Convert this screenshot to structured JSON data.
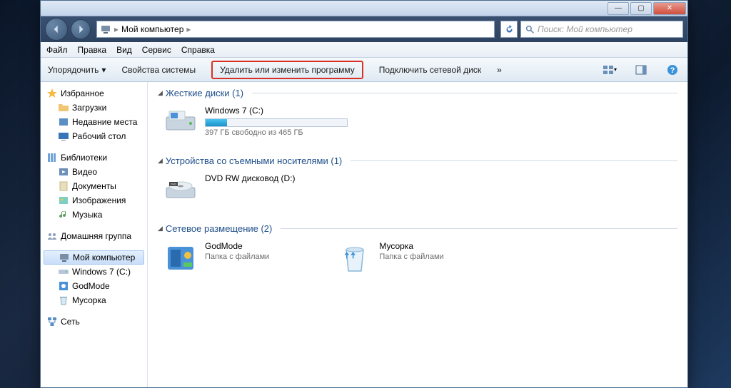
{
  "titlebar": {
    "min": "—",
    "max": "▢",
    "close": "✕"
  },
  "address": {
    "root": "Мой компьютер",
    "sep": "▸"
  },
  "search": {
    "placeholder": "Поиск: Мой компьютер"
  },
  "menu": {
    "file": "Файл",
    "edit": "Правка",
    "view": "Вид",
    "service": "Сервис",
    "help": "Справка"
  },
  "toolbar": {
    "organize": "Упорядочить",
    "system_props": "Свойства системы",
    "uninstall": "Удалить или изменить программу",
    "map_drive": "Подключить сетевой диск",
    "more": "»"
  },
  "sidebar": {
    "favorites": {
      "label": "Избранное",
      "items": [
        "Загрузки",
        "Недавние места",
        "Рабочий стол"
      ]
    },
    "libraries": {
      "label": "Библиотеки",
      "items": [
        "Видео",
        "Документы",
        "Изображения",
        "Музыка"
      ]
    },
    "homegroup": {
      "label": "Домашняя группа"
    },
    "computer": {
      "label": "Мой компьютер",
      "items": [
        "Windows 7 (C:)",
        "GodMode",
        "Мусорка"
      ]
    },
    "network": {
      "label": "Сеть"
    }
  },
  "main": {
    "cat_hdd": {
      "title": "Жесткие диски (1)",
      "drive": "Windows 7 (C:)",
      "free": "397 ГБ свободно из 465 ГБ"
    },
    "cat_rem": {
      "title": "Устройства со съемными носителями (1)",
      "drive": "DVD RW дисковод (D:)"
    },
    "cat_net": {
      "title": "Сетевое размещение (2)",
      "item1": {
        "name": "GodMode",
        "sub": "Папка с файлами"
      },
      "item2": {
        "name": "Мусорка",
        "sub": "Папка с файлами"
      }
    }
  }
}
